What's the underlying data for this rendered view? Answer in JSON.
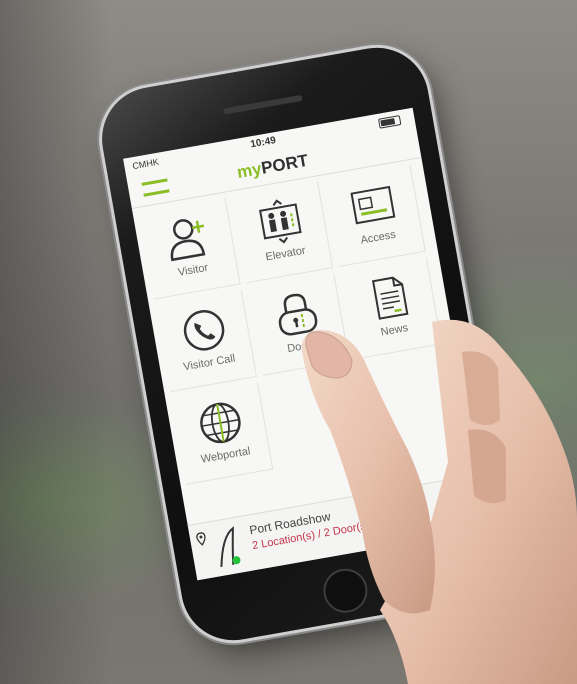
{
  "status_bar": {
    "carrier": "CMHK",
    "time": "10:49"
  },
  "app": {
    "title_prefix": "my",
    "title_suffix": "PORT",
    "accent_color": "#8bbd27"
  },
  "tiles": [
    {
      "label": "Visitor",
      "icon": "add-person-icon"
    },
    {
      "label": "Elevator",
      "icon": "elevator-icon"
    },
    {
      "label": "Access",
      "icon": "id-card-icon"
    },
    {
      "label": "Visitor Call",
      "icon": "phone-icon"
    },
    {
      "label": "Doors",
      "icon": "padlock-icon"
    },
    {
      "label": "News",
      "icon": "document-icon"
    },
    {
      "label": "Webportal",
      "icon": "globe-icon"
    }
  ],
  "footer": {
    "title": "Port Roadshow",
    "subtitle": "2 Location(s) / 2 Door(s)"
  }
}
